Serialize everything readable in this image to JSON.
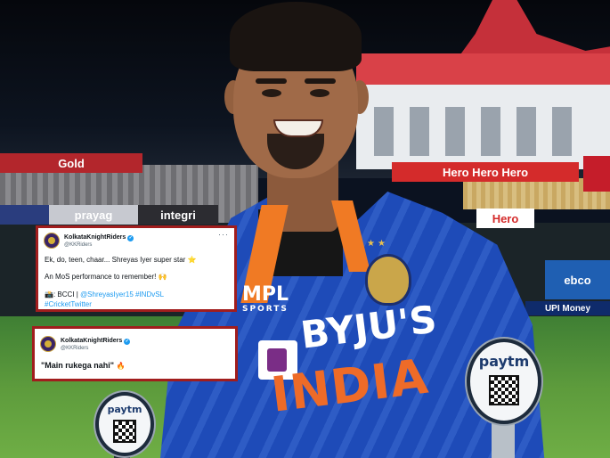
{
  "tweets": [
    {
      "name": "KolkataKnightRiders",
      "handle": "@KKRiders",
      "line1": "Ek, do, teen, chaar... Shreyas Iyer super star",
      "line1_emoji": "⭐",
      "line2": "An MoS performance to remember!",
      "line2_emoji": "🙌",
      "line3_prefix": "📸: BCCI |",
      "mention": "@ShreyasIyer15",
      "hashtag1": "#INDvSL",
      "hashtag2": "#CricketTwitter"
    },
    {
      "name": "KolkataKnightRiders",
      "handle": "@KKRiders",
      "quote": "\"Main rukega nahi\"",
      "quote_emoji": "🔥"
    }
  ],
  "scene": {
    "jersey_logo": "MPL",
    "jersey_logo_sub": "SPORTS",
    "sponsor": "BYJU'S",
    "team": "INDIA",
    "trophy_brand": "paytm",
    "hoardings": {
      "gold": "Gold",
      "hero": "Hero  Hero  Hero",
      "hero_small": "Hero",
      "prayag": "prayag",
      "integri": "integri",
      "ebco": "ebco",
      "upi": "UPI  Money"
    }
  },
  "colors": {
    "tweet_border": "#a11d1d",
    "link": "#1d9bf0",
    "jersey": "#1e4bb8",
    "accent_orange": "#f07a24"
  }
}
